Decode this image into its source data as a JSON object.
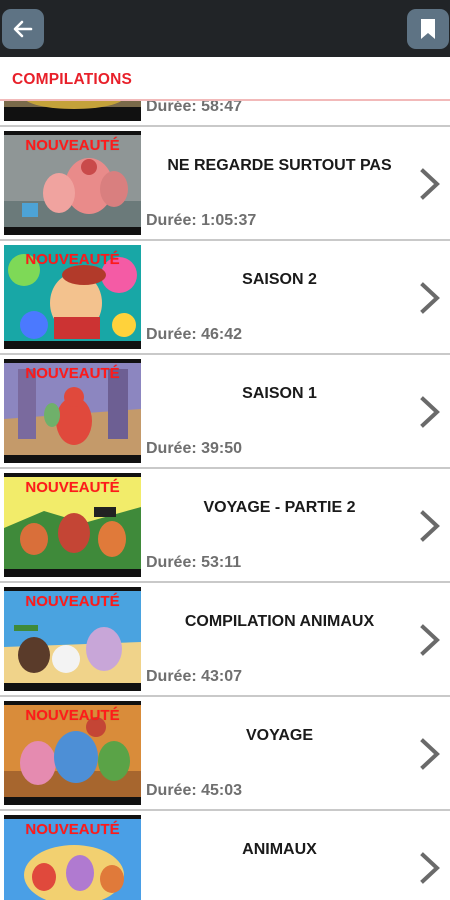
{
  "colors": {
    "topbar": "#212427",
    "button": "#5e7384",
    "accent": "#e8202a",
    "badge": "#ff1a1a"
  },
  "topbar": {
    "back_icon": "arrow-left-icon",
    "bookmark_icon": "bookmark-icon"
  },
  "section": {
    "title": "COMPILATIONS"
  },
  "partial_item": {
    "duration": "Durée: 58:47"
  },
  "items": [
    {
      "badge": "NOUVEAUTÉ",
      "title": "NE REGARDE SURTOUT PAS",
      "duration": "Durée: 1:05:37"
    },
    {
      "badge": "NOUVEAUTÉ",
      "title": "SAISON 2",
      "duration": "Durée: 46:42"
    },
    {
      "badge": "NOUVEAUTÉ",
      "title": "SAISON 1",
      "duration": "Durée: 39:50"
    },
    {
      "badge": "NOUVEAUTÉ",
      "title": "VOYAGE - PARTIE 2",
      "duration": "Durée: 53:11"
    },
    {
      "badge": "NOUVEAUTÉ",
      "title": "COMPILATION ANIMAUX",
      "duration": "Durée: 43:07"
    },
    {
      "badge": "NOUVEAUTÉ",
      "title": "VOYAGE",
      "duration": "Durée: 45:03"
    },
    {
      "badge": "NOUVEAUTÉ",
      "title": "ANIMAUX",
      "duration": ""
    }
  ]
}
